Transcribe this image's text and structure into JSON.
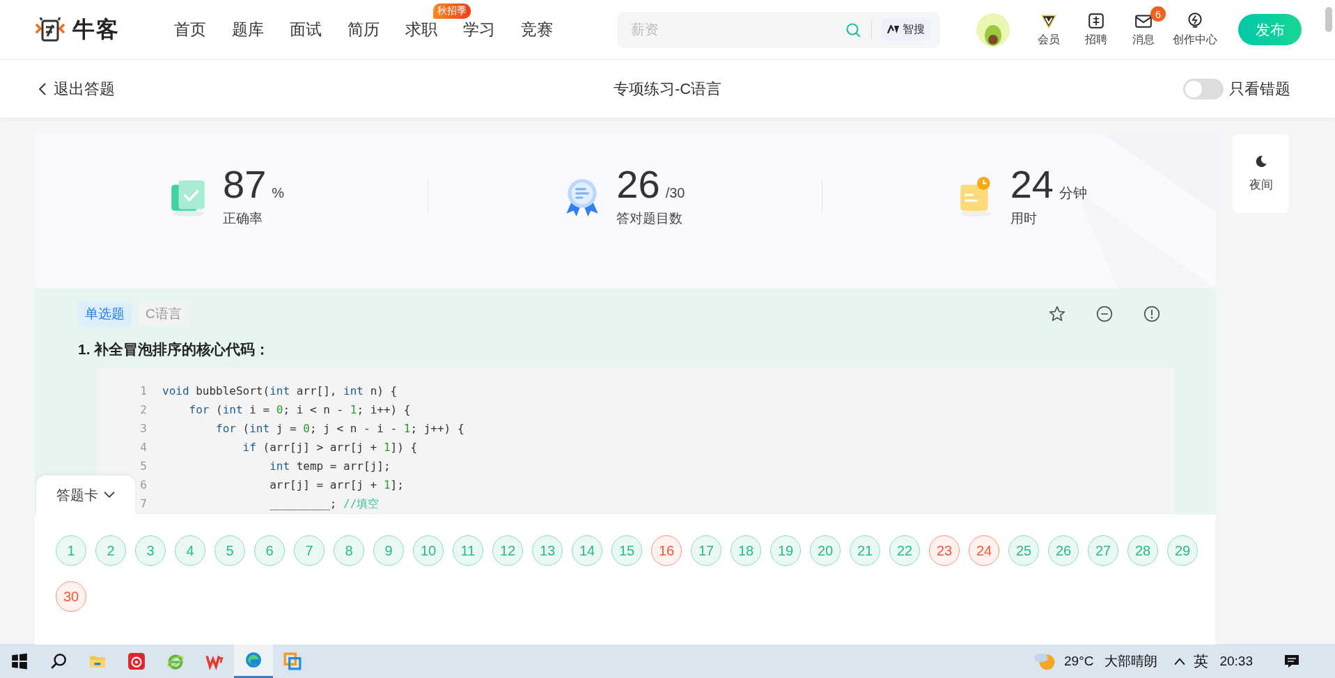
{
  "nav": {
    "logo": "牛客",
    "items": [
      {
        "label": "首页"
      },
      {
        "label": "题库"
      },
      {
        "label": "面试"
      },
      {
        "label": "简历"
      },
      {
        "label": "求职",
        "badge": "秋招季"
      },
      {
        "label": "学习"
      },
      {
        "label": "竞赛"
      }
    ],
    "search": {
      "placeholder": "薪资",
      "ai_button": "智搜"
    },
    "user_menu": [
      {
        "label": "会员",
        "kind": "vip"
      },
      {
        "label": "招聘",
        "kind": "recruit"
      },
      {
        "label": "消息",
        "kind": "message",
        "badge": "6"
      },
      {
        "label": "创作中心",
        "kind": "create"
      }
    ],
    "publish_button": "发布"
  },
  "subheader": {
    "back": "退出答题",
    "title": "专项练习-C语言",
    "wrong_only": {
      "label": "只看错题",
      "on": false
    }
  },
  "stats": [
    {
      "kind": "accuracy",
      "value": "87",
      "unit": "%",
      "label": "正确率"
    },
    {
      "kind": "correct",
      "value": "26",
      "unit": "/30",
      "label": "答对题目数"
    },
    {
      "kind": "time",
      "value": "24",
      "unit": "分钟",
      "label": "用时"
    }
  ],
  "night_button": "夜间",
  "question": {
    "tags": [
      {
        "label": "单选题",
        "kind": "type"
      },
      {
        "label": "C语言",
        "kind": "topic"
      }
    ],
    "title": "1. 补全冒泡排序的核心代码：",
    "code": [
      {
        "number": "1",
        "tokens": [
          {
            "kind": "keyword",
            "text": "void"
          },
          {
            "kind": "plain",
            "text": " bubbleSort("
          },
          {
            "kind": "keyword",
            "text": "int"
          },
          {
            "kind": "plain",
            "text": " arr[], "
          },
          {
            "kind": "keyword",
            "text": "int"
          },
          {
            "kind": "plain",
            "text": " n) {"
          }
        ]
      },
      {
        "number": "2",
        "tokens": [
          {
            "kind": "keyword",
            "text": "    for"
          },
          {
            "kind": "plain",
            "text": " ("
          },
          {
            "kind": "keyword",
            "text": "int"
          },
          {
            "kind": "plain",
            "text": " i = "
          },
          {
            "kind": "number",
            "text": "0"
          },
          {
            "kind": "plain",
            "text": "; i < n - "
          },
          {
            "kind": "number",
            "text": "1"
          },
          {
            "kind": "plain",
            "text": "; i++) {"
          }
        ]
      },
      {
        "number": "3",
        "tokens": [
          {
            "kind": "keyword",
            "text": "        for"
          },
          {
            "kind": "plain",
            "text": " ("
          },
          {
            "kind": "keyword",
            "text": "int"
          },
          {
            "kind": "plain",
            "text": " j = "
          },
          {
            "kind": "number",
            "text": "0"
          },
          {
            "kind": "plain",
            "text": "; j < n - i - "
          },
          {
            "kind": "number",
            "text": "1"
          },
          {
            "kind": "plain",
            "text": "; j++) {"
          }
        ]
      },
      {
        "number": "4",
        "tokens": [
          {
            "kind": "keyword",
            "text": "            if"
          },
          {
            "kind": "plain",
            "text": " (arr[j] > arr[j + "
          },
          {
            "kind": "number",
            "text": "1"
          },
          {
            "kind": "plain",
            "text": "]) {"
          }
        ]
      },
      {
        "number": "5",
        "tokens": [
          {
            "kind": "keyword",
            "text": "                int"
          },
          {
            "kind": "plain",
            "text": " temp = arr[j];"
          }
        ]
      },
      {
        "number": "6",
        "tokens": [
          {
            "kind": "plain",
            "text": "                arr[j] = arr[j + "
          },
          {
            "kind": "number",
            "text": "1"
          },
          {
            "kind": "plain",
            "text": "];"
          }
        ]
      },
      {
        "number": "7",
        "tokens": [
          {
            "kind": "plain",
            "text": "                _________; "
          },
          {
            "kind": "comment",
            "text": "//填空"
          }
        ]
      }
    ]
  },
  "answer_card": {
    "label": "答题卡",
    "items": [
      {
        "label": "1",
        "correct": true
      },
      {
        "label": "2",
        "correct": true
      },
      {
        "label": "3",
        "correct": true
      },
      {
        "label": "4",
        "correct": true
      },
      {
        "label": "5",
        "correct": true
      },
      {
        "label": "6",
        "correct": true
      },
      {
        "label": "7",
        "correct": true
      },
      {
        "label": "8",
        "correct": true
      },
      {
        "label": "9",
        "correct": true
      },
      {
        "label": "10",
        "correct": true
      },
      {
        "label": "11",
        "correct": true
      },
      {
        "label": "12",
        "correct": true
      },
      {
        "label": "13",
        "correct": true
      },
      {
        "label": "14",
        "correct": true
      },
      {
        "label": "15",
        "correct": true
      },
      {
        "label": "16",
        "correct": false
      },
      {
        "label": "17",
        "correct": true
      },
      {
        "label": "18",
        "correct": true
      },
      {
        "label": "19",
        "correct": true
      },
      {
        "label": "20",
        "correct": true
      },
      {
        "label": "21",
        "correct": true
      },
      {
        "label": "22",
        "correct": true
      },
      {
        "label": "23",
        "correct": false
      },
      {
        "label": "24",
        "correct": false
      },
      {
        "label": "25",
        "correct": true
      },
      {
        "label": "26",
        "correct": true
      },
      {
        "label": "27",
        "correct": true
      },
      {
        "label": "28",
        "correct": true
      },
      {
        "label": "29",
        "correct": true
      },
      {
        "label": "30",
        "correct": false
      }
    ]
  },
  "taskbar": {
    "apps": [
      {
        "kind": "start",
        "selected": false
      },
      {
        "kind": "search",
        "selected": false
      },
      {
        "kind": "folder",
        "selected": false
      },
      {
        "kind": "music",
        "selected": false
      },
      {
        "kind": "browser-old",
        "selected": false
      },
      {
        "kind": "office",
        "selected": false
      },
      {
        "kind": "edge",
        "selected": true
      },
      {
        "kind": "squares",
        "selected": false
      }
    ],
    "temperature": "29°C",
    "weather": "大部晴朗",
    "ime": "英",
    "time": "20:33"
  }
}
